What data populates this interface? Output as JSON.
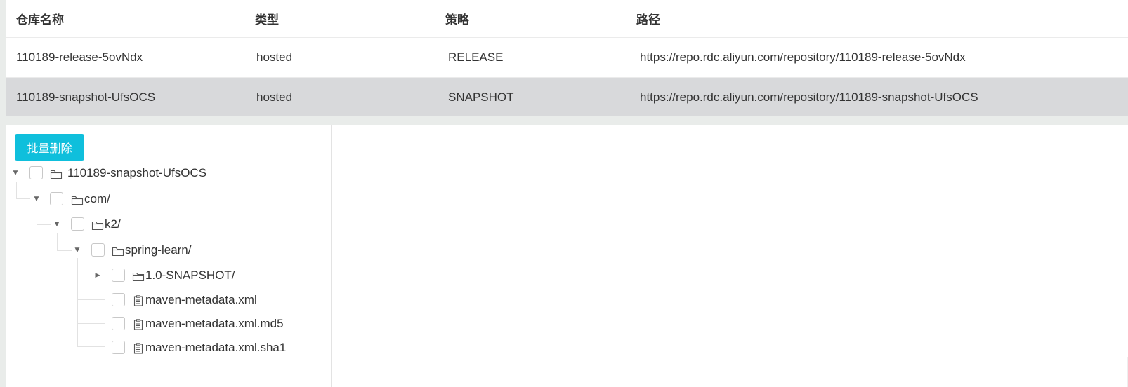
{
  "table": {
    "headers": {
      "name": "仓库名称",
      "type": "类型",
      "policy": "策略",
      "path": "路径"
    },
    "rows": [
      {
        "name": "110189-release-5ovNdx",
        "type": "hosted",
        "policy": "RELEASE",
        "path": "https://repo.rdc.aliyun.com/repository/110189-release-5ovNdx"
      },
      {
        "name": "110189-snapshot-UfsOCS",
        "type": "hosted",
        "policy": "SNAPSHOT",
        "path": "https://repo.rdc.aliyun.com/repository/110189-snapshot-UfsOCS"
      }
    ],
    "selected_row_index": 1,
    "selected_row_color": "#d8d9db"
  },
  "toolbar": {
    "batch_delete_label": "批量删除",
    "batch_delete_color": "#0fbfdc"
  },
  "tree": {
    "root": {
      "label": "110189-snapshot-UfsOCS",
      "expanded": true,
      "icon": "folder-icon"
    },
    "com": {
      "label": "com/",
      "expanded": true,
      "icon": "folder-icon"
    },
    "k2": {
      "label": "k2/",
      "expanded": true,
      "icon": "folder-icon"
    },
    "spring_learn": {
      "label": "spring-learn/",
      "expanded": true,
      "icon": "folder-icon"
    },
    "snapshot_dir": {
      "label": "1.0-SNAPSHOT/",
      "expanded": false,
      "icon": "folder-icon"
    },
    "files": [
      {
        "label": "maven-metadata.xml",
        "icon": "file-icon"
      },
      {
        "label": "maven-metadata.xml.md5",
        "icon": "file-icon"
      },
      {
        "label": "maven-metadata.xml.sha1",
        "icon": "file-icon"
      }
    ]
  }
}
